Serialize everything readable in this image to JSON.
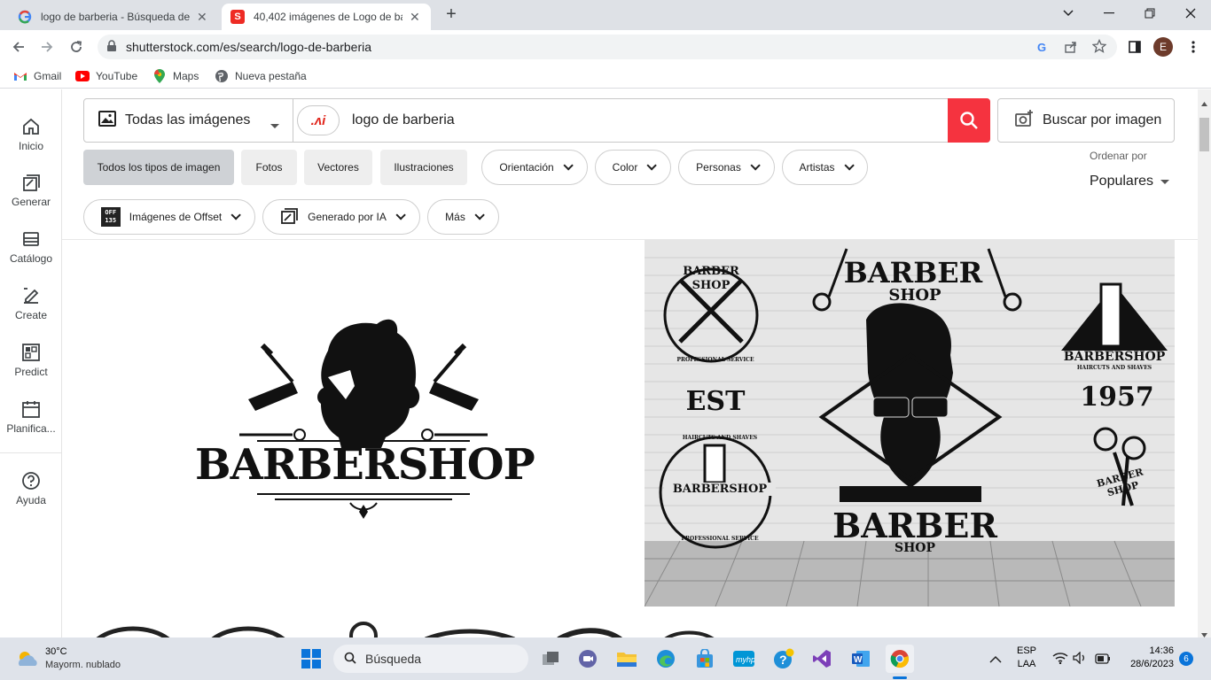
{
  "browser": {
    "tabs": [
      {
        "title": "logo de barberia - Búsqueda de G",
        "favicon": "google-icon",
        "active": false
      },
      {
        "title": "40,402 imágenes de Logo de bar",
        "favicon": "shutterstock-icon",
        "active": true
      }
    ],
    "new_tab_symbol": "+",
    "url": "shutterstock.com/es/search/logo-de-barberia",
    "profile_initial": "E",
    "bookmarks": [
      {
        "label": "Gmail",
        "icon": "gmail-icon"
      },
      {
        "label": "YouTube",
        "icon": "youtube-icon"
      },
      {
        "label": "Maps",
        "icon": "maps-icon"
      },
      {
        "label": "Nueva pestaña",
        "icon": "globe-icon"
      }
    ]
  },
  "sidebar": {
    "items": [
      {
        "label": "Inicio",
        "icon": "home-icon"
      },
      {
        "label": "Generar",
        "icon": "generate-icon"
      },
      {
        "label": "Catálogo",
        "icon": "catalog-icon"
      },
      {
        "label": "Create",
        "icon": "create-icon"
      },
      {
        "label": "Predict",
        "icon": "predict-icon"
      },
      {
        "label": "Planifica...",
        "icon": "calendar-icon"
      },
      {
        "label": "Ayuda",
        "icon": "help-icon"
      }
    ]
  },
  "search": {
    "type_selector": "Todas las imágenes",
    "query": "logo de barberia",
    "ai_badge": ".ʌi",
    "search_by_image": "Buscar por imagen"
  },
  "filters": {
    "types": [
      "Todos los tipos de imagen",
      "Fotos",
      "Vectores",
      "Ilustraciones"
    ],
    "dropdowns": [
      "Orientación",
      "Color",
      "Personas",
      "Artistas"
    ],
    "second_row": [
      "Imágenes de Offset",
      "Generado por IA",
      "Más"
    ],
    "offset_badge": [
      "OFF",
      "135"
    ],
    "sort_label": "Ordenar por",
    "sort_value": "Populares"
  },
  "results": {
    "image1": {
      "banner": "BARBERSHOP"
    },
    "image2": {
      "title_top": "BARBER",
      "subtitle_top": "SHOP",
      "badge_left_top": [
        "BARBER",
        "SHOP"
      ],
      "badge_left_top_ring": "PROFESSIONAL SERVICE",
      "est": "EST",
      "badge_left_bottom_ring": "HAIRCUTS AND SHAVES",
      "badge_left_bottom": "BARBERSHOP",
      "badge_left_bottom_ring2": "PROFESSIONAL SERVICE",
      "badge_right_top": "BARBERSHOP",
      "badge_right_top_sub": "HAIRCUTS AND SHAVES",
      "year": "1957",
      "badge_right_bottom": [
        "BARBER",
        "SHOP"
      ],
      "title_bottom": "BARBER",
      "subtitle_bottom": "SHOP"
    }
  },
  "taskbar": {
    "weather_temp": "30°C",
    "weather_desc": "Mayorm. nublado",
    "search_label": "Búsqueda",
    "lang_top": "ESP",
    "lang_bottom": "LAA",
    "time": "14:36",
    "date": "28/6/2023",
    "notification_count": "6"
  }
}
